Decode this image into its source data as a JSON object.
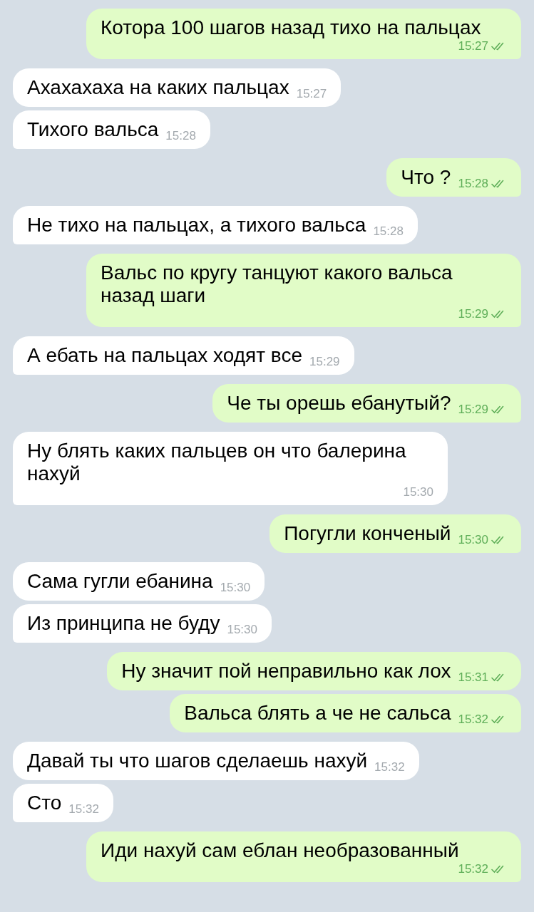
{
  "messages": [
    {
      "kind": "out",
      "text": "Котора 100 шагов назад тихо на пальцах",
      "time": "15:27",
      "read": true
    },
    {
      "kind": "in",
      "text": "Ахахахаха на каких пальцах",
      "time": "15:27"
    },
    {
      "kind": "in",
      "text": "Тихого вальса",
      "time": "15:28"
    },
    {
      "kind": "out",
      "text": "Что ?",
      "time": "15:28",
      "read": true
    },
    {
      "kind": "in",
      "text": "Не тихо на пальцах, а тихого вальса",
      "time": "15:28"
    },
    {
      "kind": "out",
      "text": "Вальс по кругу танцуют какого вальса назад шаги",
      "time": "15:29",
      "read": true
    },
    {
      "kind": "in",
      "text": "А ебать на пальцах ходят все",
      "time": "15:29"
    },
    {
      "kind": "out",
      "text": "Че ты орешь ебанутый?",
      "time": "15:29",
      "read": true
    },
    {
      "kind": "in",
      "text": "Ну блять каких пальцев он что балерина нахуй",
      "time": "15:30"
    },
    {
      "kind": "out",
      "text": "Погугли конченый",
      "time": "15:30",
      "read": true
    },
    {
      "kind": "in",
      "text": "Сама гугли ебанина",
      "time": "15:30"
    },
    {
      "kind": "in",
      "text": "Из принципа не буду",
      "time": "15:30"
    },
    {
      "kind": "out",
      "text": "Ну значит пой неправильно как лох",
      "time": "15:31",
      "read": true
    },
    {
      "kind": "out",
      "text": "Вальса блять а че не сальса",
      "time": "15:32",
      "read": true
    },
    {
      "kind": "in",
      "text": "Давай ты что шагов сделаешь нахуй",
      "time": "15:32"
    },
    {
      "kind": "in",
      "text": "Сто",
      "time": "15:32"
    },
    {
      "kind": "out",
      "text": "Иди нахуй сам еблан необразованный",
      "time": "15:32",
      "read": true
    }
  ]
}
